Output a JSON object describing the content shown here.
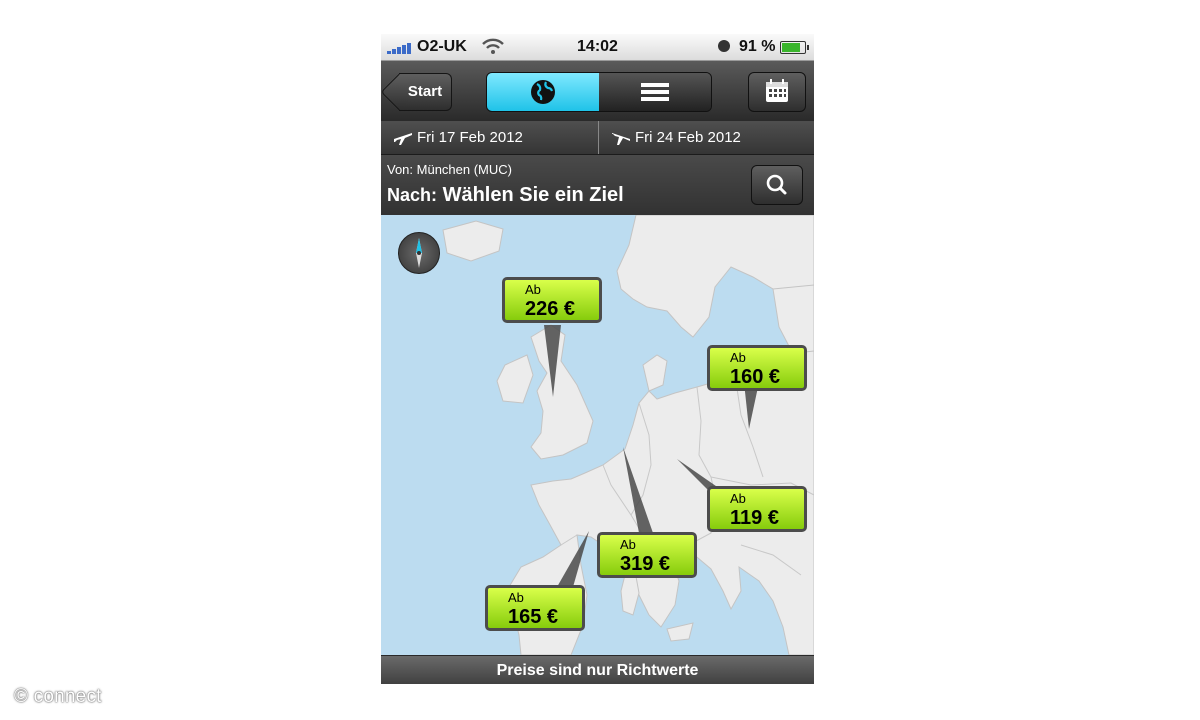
{
  "status_bar": {
    "carrier": "O2-UK",
    "time": "14:02",
    "battery_percent": "91 %",
    "battery_level": 0.91,
    "icons": [
      "signal-bars-icon",
      "wifi-icon",
      "clock-lock-icon",
      "battery-icon"
    ]
  },
  "nav": {
    "back_label": "Start",
    "segments": [
      "globe-icon",
      "list-icon"
    ],
    "selected_segment": 0,
    "calendar_icon": "calendar-icon"
  },
  "dates": {
    "departure": "Fri 17 Feb 2012",
    "return": "Fri 24 Feb 2012"
  },
  "route": {
    "from": "Von: München (MUC)",
    "to_label": "Nach:",
    "to_value": "Wählen Sie ein Ziel"
  },
  "map": {
    "prices": [
      {
        "prefix": "Ab",
        "amount": "226 €"
      },
      {
        "prefix": "Ab",
        "amount": "160 €"
      },
      {
        "prefix": "Ab",
        "amount": "119 €"
      },
      {
        "prefix": "Ab",
        "amount": "319 €"
      },
      {
        "prefix": "Ab",
        "amount": "165 €"
      }
    ]
  },
  "footer": {
    "note": "Preise sind nur Richtwerte"
  },
  "watermark": "© connect",
  "colors": {
    "accent_cyan": "#1fc3e8",
    "price_green": "#a4e61e",
    "sea": "#bcdcf0",
    "land": "#ececec"
  }
}
